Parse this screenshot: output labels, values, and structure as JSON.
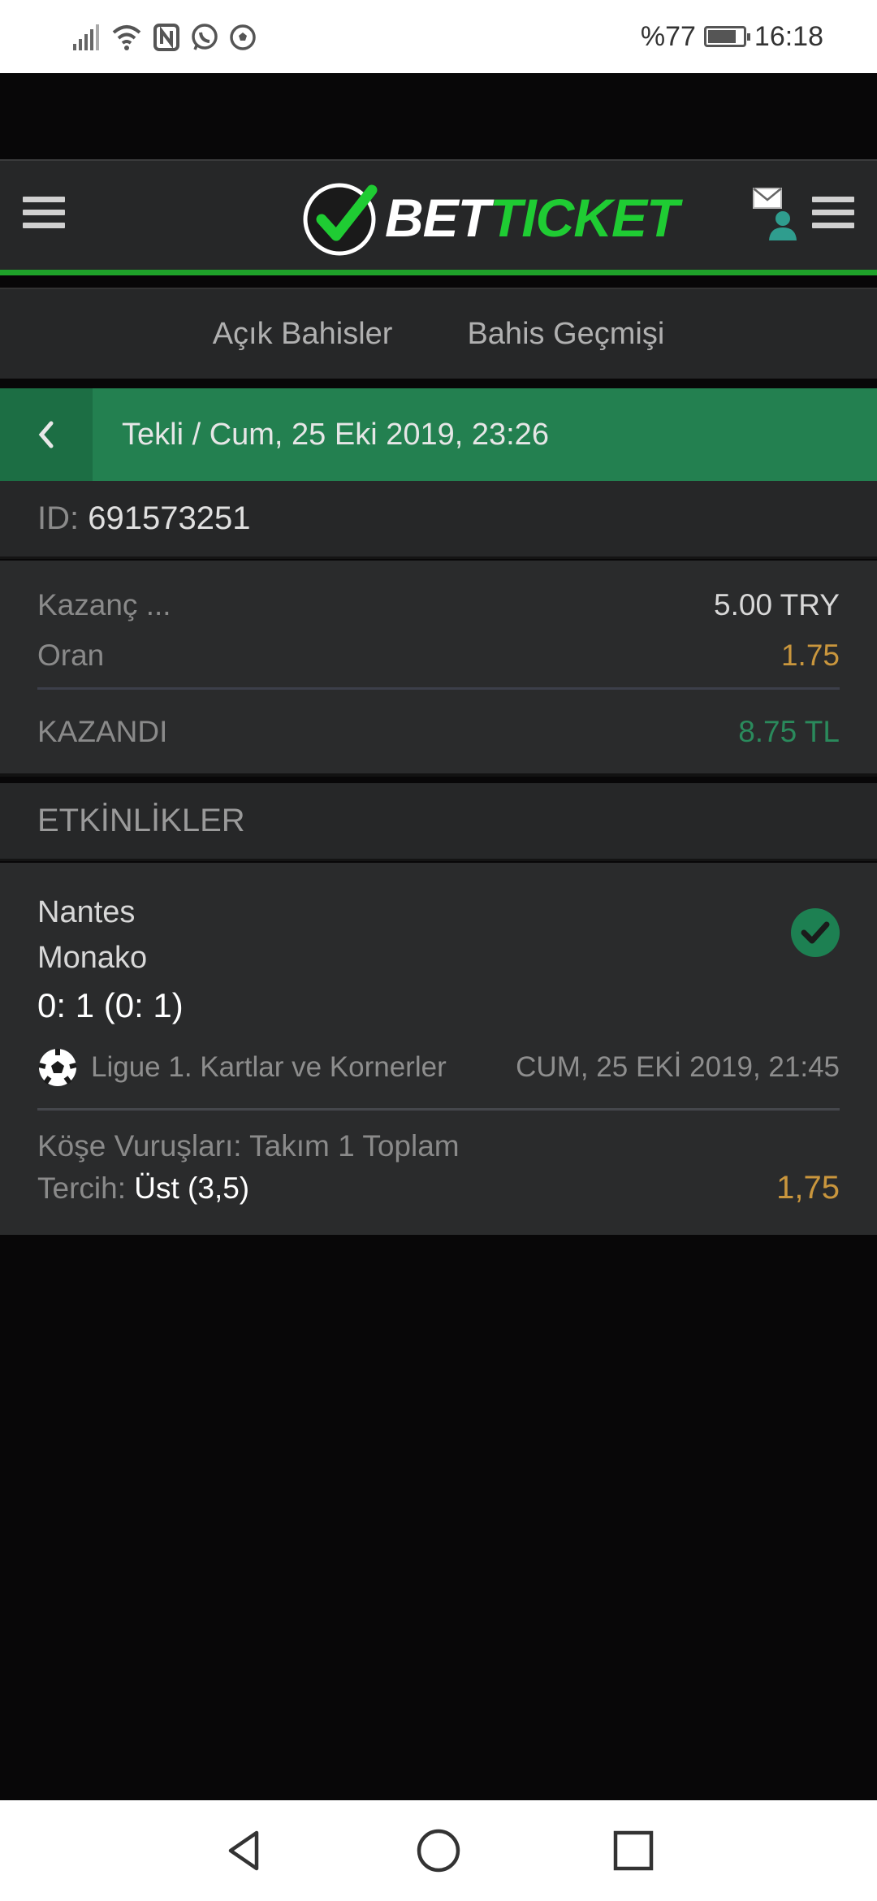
{
  "statusbar": {
    "battery_text": "%77",
    "time": "16:18",
    "battery_level": 0.77
  },
  "header": {
    "logo_bet": "BET",
    "logo_ticket": "ICKET",
    "logo_t_prefix": "T"
  },
  "tabs": [
    {
      "label": "Açık Bahisler"
    },
    {
      "label": "Bahis Geçmişi"
    }
  ],
  "ticket": {
    "title": "Tekli / Cum, 25 Eki 2019, 23:26",
    "id_label": "ID:",
    "id_value": "691573251",
    "stake_label": "Kazanç ...",
    "stake_value": "5.00 TRY",
    "odds_label": "Oran",
    "odds_value": "1.75",
    "status_label": "KAZANDI",
    "payout_value": "8.75 TL"
  },
  "events_section": {
    "title": "ETKİNLİKLER"
  },
  "event": {
    "home": "Nantes",
    "away": "Monako",
    "score": "0: 1 (0: 1)",
    "league": "Ligue 1. Kartlar ve Kornerler",
    "date": "CUM, 25 EKİ 2019, 21:45",
    "market": "Köşe Vuruşları: Takım 1 Toplam",
    "pick_label": "Tercih:",
    "pick_value": "Üst (3,5)",
    "odds": "1,75"
  },
  "colors": {
    "brand_green": "#1fcc33",
    "win_green": "#238050",
    "odds_gold": "#c9963d",
    "payout_green": "#2a8a5c"
  }
}
